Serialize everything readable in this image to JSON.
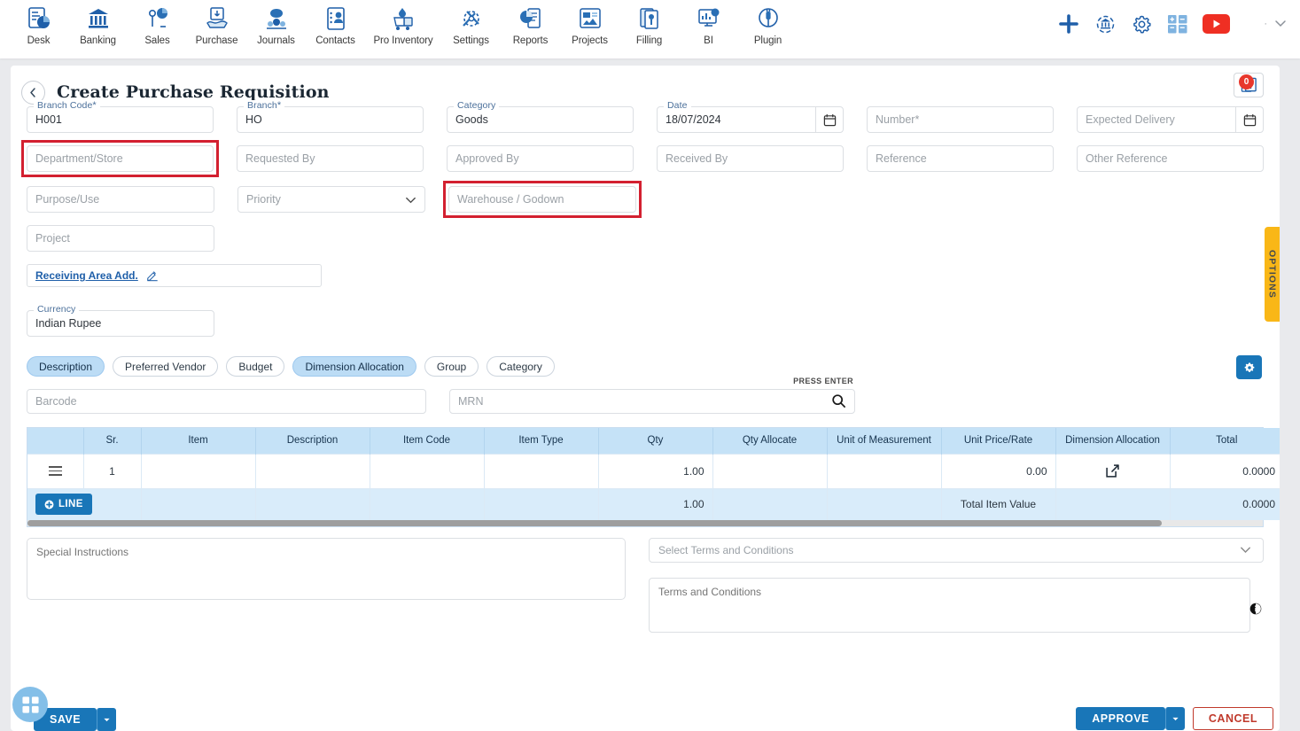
{
  "topnav": {
    "items": [
      {
        "label": "Desk",
        "icon": "desk-dashboard-icon"
      },
      {
        "label": "Banking",
        "icon": "bank-icon"
      },
      {
        "label": "Sales",
        "icon": "sales-icon"
      },
      {
        "label": "Purchase",
        "icon": "purchase-icon"
      },
      {
        "label": "Journals",
        "icon": "journals-icon"
      },
      {
        "label": "Contacts",
        "icon": "contacts-icon"
      },
      {
        "label": "Pro Inventory",
        "icon": "pro-inventory-icon"
      },
      {
        "label": "Settings",
        "icon": "settings-tools-icon"
      },
      {
        "label": "Reports",
        "icon": "reports-icon"
      },
      {
        "label": "Projects",
        "icon": "projects-icon"
      },
      {
        "label": "Filling",
        "icon": "filling-icon"
      },
      {
        "label": "BI",
        "icon": "bi-icon"
      },
      {
        "label": "Plugin",
        "icon": "plugin-icon"
      }
    ],
    "right_icons": [
      {
        "name": "add-plus-icon"
      },
      {
        "name": "company-switch-icon"
      },
      {
        "name": "gear-icon"
      },
      {
        "name": "calculator-icon"
      },
      {
        "name": "youtube-icon"
      }
    ],
    "user_menu": "chevron-down-icon"
  },
  "header": {
    "back": "back-chevron-icon",
    "title": "Create Purchase Requisition",
    "upload_icon": "upload-attachment-icon",
    "upload_badge": "0"
  },
  "options_tab": {
    "label": "OPTIONS"
  },
  "form": {
    "row1": [
      {
        "label": "Branch Code",
        "required": true,
        "value": "H001",
        "placeholder": "",
        "name": "branch-code"
      },
      {
        "label": "Branch",
        "required": true,
        "value": "HO",
        "placeholder": "",
        "name": "branch"
      },
      {
        "label": "Category",
        "required": false,
        "value": "Goods",
        "placeholder": "",
        "name": "category"
      },
      {
        "label": "Date",
        "required": false,
        "value": "18/07/2024",
        "placeholder": "",
        "name": "date",
        "icon": "calendar-icon"
      },
      {
        "label": "",
        "required": false,
        "value": "",
        "placeholder": "Number*",
        "name": "number"
      },
      {
        "label": "",
        "required": false,
        "value": "",
        "placeholder": "Expected Delivery",
        "name": "expected-delivery",
        "icon": "calendar-icon"
      }
    ],
    "row2": [
      {
        "placeholder": "Department/Store",
        "name": "department-store",
        "highlight": true
      },
      {
        "placeholder": "Requested By",
        "name": "requested-by"
      },
      {
        "placeholder": "Approved By",
        "name": "approved-by"
      },
      {
        "placeholder": "Received By",
        "name": "received-by"
      },
      {
        "placeholder": "Reference",
        "name": "reference"
      },
      {
        "placeholder": "Other Reference",
        "name": "other-reference"
      }
    ],
    "row3": [
      {
        "placeholder": "Purpose/Use",
        "name": "purpose-use"
      },
      {
        "placeholder": "Priority",
        "name": "priority",
        "icon": "chevron-down-icon"
      },
      {
        "placeholder": "Warehouse / Godown",
        "name": "warehouse-godown",
        "highlight": true
      }
    ],
    "project": {
      "placeholder": "Project",
      "name": "project"
    },
    "receiving_area": {
      "link": "Receiving Area Add.",
      "icon": "edit-pencil-icon"
    },
    "currency": {
      "label": "Currency",
      "value": "Indian Rupee",
      "name": "currency"
    },
    "grid_settings_icon": "grid-settings-gear-icon"
  },
  "chips": [
    {
      "label": "Description",
      "active": true
    },
    {
      "label": "Preferred Vendor",
      "active": false
    },
    {
      "label": "Budget",
      "active": false
    },
    {
      "label": "Dimension Allocation",
      "active": true
    },
    {
      "label": "Group",
      "active": false
    },
    {
      "label": "Category",
      "active": false
    }
  ],
  "search": {
    "barcode_placeholder": "Barcode",
    "mrn_placeholder": "MRN",
    "press_enter": "PRESS ENTER",
    "search_icon": "search-icon"
  },
  "table": {
    "columns": [
      "",
      "Sr.",
      "Item",
      "Description",
      "Item Code",
      "Item Type",
      "Qty",
      "Qty Allocate",
      "Unit of Measurement",
      "Unit Price/Rate",
      "Dimension Allocation",
      "Total"
    ],
    "rows": [
      {
        "handle": "drag-handle-icon",
        "sr": "1",
        "item": "",
        "description": "",
        "item_code": "",
        "item_type": "",
        "qty": "1.00",
        "qty_allocate": "",
        "uom": "",
        "unit_price": "0.00",
        "dimension_allocation": "open-external-icon",
        "total": "0.0000"
      }
    ],
    "footer": {
      "add_line_label": "LINE",
      "add_line_icon": "plus-circle-icon",
      "qty": "1.00",
      "total_item_value_label": "Total Item Value",
      "total": "0.0000"
    }
  },
  "bottom": {
    "special_instructions_placeholder": "Special Instructions",
    "select_terms_placeholder": "Select Terms and Conditions",
    "terms_placeholder": "Terms and Conditions",
    "select_chevron": "chevron-down-icon",
    "info_icon": "info-icon"
  },
  "actions": {
    "fab_icon": "apps-grid-icon",
    "save": "SAVE",
    "save_dropdown": "caret-down-icon",
    "approve": "APPROVE",
    "approve_dropdown": "caret-down-icon",
    "cancel": "CANCEL"
  },
  "colors": {
    "primary": "#1976b8",
    "danger": "#c0392b",
    "highlight": "#d32030",
    "accent_yellow": "#f9b717",
    "header_blue": "#c5e2f7"
  }
}
